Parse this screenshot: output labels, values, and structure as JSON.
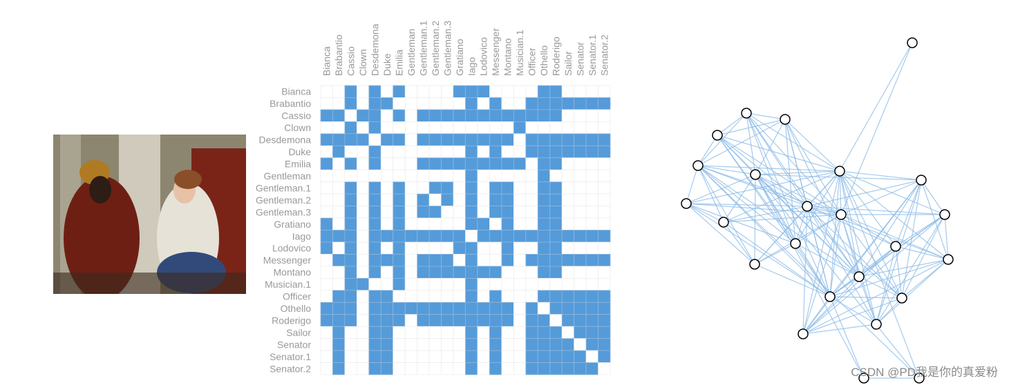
{
  "chart_data": [
    {
      "type": "heatmap",
      "description_of_cells": "adjacency matrix",
      "rows": [
        "Bianca",
        "Brabantio",
        "Cassio",
        "Clown",
        "Desdemona",
        "Duke",
        "Emilia",
        "Gentleman",
        "Gentleman.1",
        "Gentleman.2",
        "Gentleman.3",
        "Gratiano",
        "Iago",
        "Lodovico",
        "Messenger",
        "Montano",
        "Musician.1",
        "Officer",
        "Othello",
        "Roderigo",
        "Sailor",
        "Senator",
        "Senator.1",
        "Senator.2"
      ],
      "columns": [
        "Bianca",
        "Brabantio",
        "Cassio",
        "Clown",
        "Desdemona",
        "Duke",
        "Emilia",
        "Gentleman",
        "Gentleman.1",
        "Gentleman.2",
        "Gentleman.3",
        "Gratiano",
        "Iago",
        "Lodovico",
        "Messenger",
        "Montano",
        "Musician.1",
        "Officer",
        "Othello",
        "Roderigo",
        "Sailor",
        "Senator",
        "Senator.1",
        "Senator.2"
      ],
      "links": [
        [
          2,
          4,
          6,
          11,
          12,
          13,
          18,
          19
        ],
        [
          2,
          4,
          5,
          12,
          14,
          17,
          18,
          19,
          20,
          21,
          22,
          23
        ],
        [
          0,
          1,
          3,
          4,
          6,
          8,
          9,
          10,
          11,
          12,
          13,
          14,
          15,
          16,
          17,
          18,
          19
        ],
        [
          2,
          4,
          16
        ],
        [
          0,
          1,
          2,
          3,
          5,
          6,
          8,
          9,
          10,
          11,
          12,
          13,
          14,
          15,
          17,
          18,
          19,
          20,
          21,
          22,
          23
        ],
        [
          1,
          4,
          12,
          14,
          17,
          18,
          19,
          20,
          21,
          22,
          23
        ],
        [
          0,
          2,
          4,
          8,
          9,
          10,
          11,
          12,
          13,
          14,
          15,
          16,
          18,
          19
        ],
        [
          12,
          18
        ],
        [
          2,
          4,
          6,
          9,
          10,
          12,
          14,
          15,
          18,
          19
        ],
        [
          2,
          4,
          6,
          8,
          10,
          12,
          14,
          15,
          18,
          19
        ],
        [
          2,
          4,
          6,
          8,
          9,
          12,
          14,
          15,
          18,
          19
        ],
        [
          0,
          2,
          4,
          6,
          12,
          13,
          15,
          18,
          19
        ],
        [
          0,
          1,
          2,
          4,
          5,
          6,
          7,
          8,
          9,
          10,
          11,
          13,
          14,
          15,
          16,
          17,
          18,
          19,
          20,
          21,
          22,
          23
        ],
        [
          0,
          2,
          4,
          6,
          11,
          12,
          15,
          18,
          19
        ],
        [
          1,
          2,
          4,
          5,
          6,
          8,
          9,
          10,
          12,
          15,
          17,
          18,
          19,
          20,
          21,
          22,
          23
        ],
        [
          2,
          4,
          6,
          8,
          9,
          10,
          11,
          12,
          13,
          14,
          18,
          19
        ],
        [
          2,
          3,
          6,
          12
        ],
        [
          1,
          2,
          4,
          5,
          12,
          14,
          18,
          19,
          20,
          21,
          22,
          23
        ],
        [
          0,
          1,
          2,
          4,
          5,
          6,
          7,
          8,
          9,
          10,
          11,
          12,
          13,
          14,
          15,
          17,
          19,
          20,
          21,
          22,
          23
        ],
        [
          0,
          1,
          2,
          4,
          5,
          6,
          8,
          9,
          10,
          11,
          12,
          13,
          14,
          15,
          17,
          18,
          20,
          21,
          22,
          23
        ],
        [
          1,
          4,
          5,
          12,
          14,
          17,
          18,
          19,
          21,
          22,
          23
        ],
        [
          1,
          4,
          5,
          12,
          14,
          17,
          18,
          19,
          20,
          22,
          23
        ],
        [
          1,
          4,
          5,
          12,
          14,
          17,
          18,
          19,
          20,
          21,
          23
        ],
        [
          1,
          4,
          5,
          12,
          14,
          17,
          18,
          19,
          20,
          21,
          22
        ]
      ],
      "cell_color": "#559bd9",
      "grid_color": "#eeeeee",
      "label_color": "#999999"
    },
    {
      "type": "network",
      "nodes_from": "same characters as matrix",
      "edge_color": "#8fbde8",
      "node_fill": "#ffffff",
      "node_stroke": "#000000"
    }
  ],
  "watermark": "CSDN @PD我是你的真爱粉"
}
